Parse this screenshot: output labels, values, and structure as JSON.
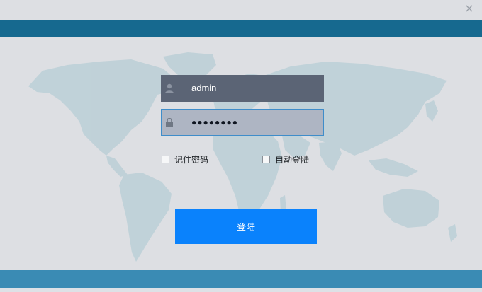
{
  "window": {
    "close_glyph": "×"
  },
  "login": {
    "username_value": "admin",
    "password_value": "●●●●●●●●",
    "remember_label": "记住密码",
    "autologin_label": "自动登陆",
    "login_label": "登陆"
  },
  "icons": {
    "user": "user-icon",
    "lock": "lock-icon",
    "close": "close-icon",
    "map": "world-map"
  },
  "colors": {
    "header_band": "#16698f",
    "footer_band": "#3a8bb4",
    "login_button": "#0a82fc",
    "username_bg": "#5b6475",
    "password_border": "#3f8dca",
    "map_land": "#bccfd6"
  }
}
